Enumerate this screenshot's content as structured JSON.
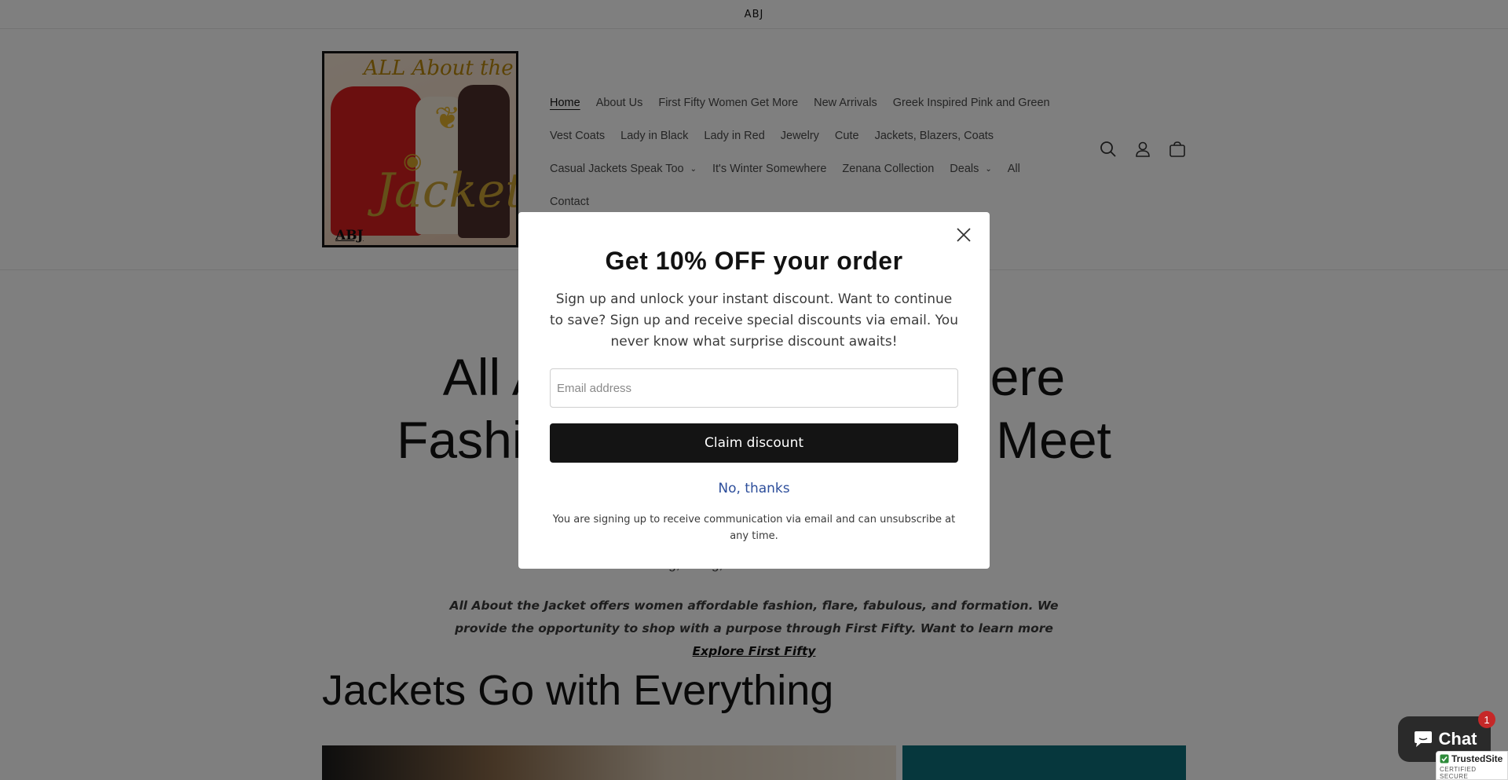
{
  "announcement": {
    "text": "ABJ"
  },
  "logo": {
    "title": "ALL About the",
    "script": "Jacket",
    "abbr": "ABJ"
  },
  "nav": {
    "rows": [
      [
        "Home",
        "About Us",
        "First Fifty Women Get More",
        "New Arrivals",
        "Greek Inspired Pink and Green"
      ],
      [
        "Vest Coats",
        "Lady in Black",
        "Lady in Red",
        "Jewelry",
        "Cute",
        "Jackets, Blazers, Coats"
      ],
      [
        "Casual Jackets Speak Too",
        "It's Winter Somewhere",
        "Zenana Collection",
        "Deals",
        "All"
      ],
      [
        "Contact"
      ]
    ],
    "active": "Home",
    "dropdown_items": [
      "Casual Jackets Speak Too",
      "Deals"
    ]
  },
  "header_icons": [
    "search-icon",
    "account-icon",
    "cart-icon"
  ],
  "hero": {
    "title_line1": "All About the Jacket Where",
    "title_line2": "Fashion, Faith & Purpose Meet",
    "subtitle": "Going, Going, Grab it before it's Gone!",
    "description": "All About the Jacket offers women affordable fashion, flare, fabulous, and formation. We provide the opportunity to shop with a purpose through First Fifty. Want to learn more ",
    "link_text": "Explore First Fifty"
  },
  "section": {
    "title": "Jackets Go with Everything"
  },
  "modal": {
    "title": "Get 10% OFF your order",
    "text": "Sign up and unlock your instant discount. Want to  continue to save? Sign up and receive special discounts via email. You never know what surprise discount awaits!",
    "email_placeholder": "Email address",
    "email_value": "",
    "claim_label": "Claim discount",
    "decline_label": "No, thanks",
    "disclaimer": "You are signing up to receive communication via email and can unsubscribe at any time."
  },
  "chat": {
    "label": "Chat",
    "badge": "1"
  },
  "trusted_site": {
    "title": "TrustedSite",
    "subtitle": "CERTIFIED SECURE"
  },
  "colors": {
    "overlay": "#00000080",
    "button": "#141414",
    "link": "#2d4e9b",
    "badge": "#c62828"
  }
}
